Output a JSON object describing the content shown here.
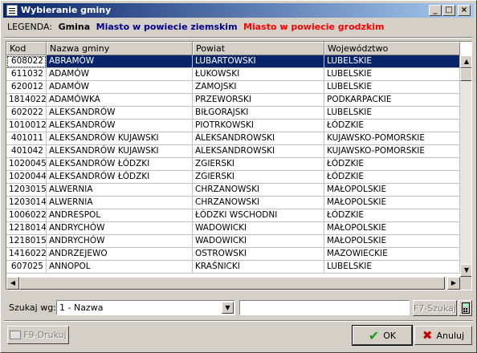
{
  "window": {
    "title": "Wybieranie gminy"
  },
  "titlebar_buttons": {
    "minimize": "_",
    "maximize": "□",
    "close": "×"
  },
  "legend": {
    "label": "LEGENDA:",
    "gmina": "Gmina",
    "miasto": "Miasto w powiecie ziemskim",
    "grodzkie": "Miasto w powiecie grodzkim",
    "colors": {
      "gmina": "#000000",
      "miasto": "#00008b",
      "grodzkie": "#ff0000"
    }
  },
  "table": {
    "headers": [
      "Kod",
      "Nazwa gminy",
      "Powiat",
      "Województwo"
    ],
    "selected_index": 0,
    "rows": [
      [
        "608022",
        "ABRAMÓW",
        "LUBARTOWSKI",
        "LUBELSKIE"
      ],
      [
        "611032",
        "ADAMÓW",
        "ŁUKOWSKI",
        "LUBELSKIE"
      ],
      [
        "620012",
        "ADAMÓW",
        "ZAMOJSKI",
        "LUBELSKIE"
      ],
      [
        "1814022",
        "ADAMÓWKA",
        "PRZEWORSKI",
        "PODKARPACKIE"
      ],
      [
        "602022",
        "ALEKSANDRÓW",
        "BIŁGORAJSKI",
        "LUBELSKIE"
      ],
      [
        "1010012",
        "ALEKSANDRÓW",
        "PIOTRKOWSKI",
        "ŁÓDZKIE"
      ],
      [
        "401011",
        "ALEKSANDRÓW KUJAWSKI",
        "ALEKSANDROWSKI",
        "KUJAWSKO-POMORSKIE"
      ],
      [
        "401042",
        "ALEKSANDRÓW KUJAWSKI",
        "ALEKSANDROWSKI",
        "KUJAWSKO-POMORSKIE"
      ],
      [
        "1020045",
        "ALEKSANDRÓW ŁÓDZKI",
        "ZGIERSKI",
        "ŁÓDZKIE"
      ],
      [
        "1020044",
        "ALEKSANDRÓW ŁÓDZKI",
        "ZGIERSKI",
        "ŁÓDZKIE"
      ],
      [
        "1203015",
        "ALWERNIA",
        "CHRZANOWSKI",
        "MAŁOPOLSKIE"
      ],
      [
        "1203014",
        "ALWERNIA",
        "CHRZANOWSKI",
        "MAŁOPOLSKIE"
      ],
      [
        "1006022",
        "ANDRESPOL",
        "ŁÓDZKI WSCHODNI",
        "ŁÓDZKIE"
      ],
      [
        "1218014",
        "ANDRYCHÓW",
        "WADOWICKI",
        "MAŁOPOLSKIE"
      ],
      [
        "1218015",
        "ANDRYCHÓW",
        "WADOWICKI",
        "MAŁOPOLSKIE"
      ],
      [
        "1416022",
        "ANDRZEJEWO",
        "OSTROWSKI",
        "MAZOWIECKIE"
      ],
      [
        "607025",
        "ANNOPOL",
        "KRAŚNICKI",
        "LUBELSKIE"
      ]
    ]
  },
  "search": {
    "label": "Szukaj wg:",
    "mode_value": "1 - Nazwa",
    "input_value": "",
    "find_button": "F7-Szukaj"
  },
  "footer": {
    "print_button": "F9-Drukuj",
    "ok_button": "OK",
    "cancel_button": "Anuluj"
  }
}
